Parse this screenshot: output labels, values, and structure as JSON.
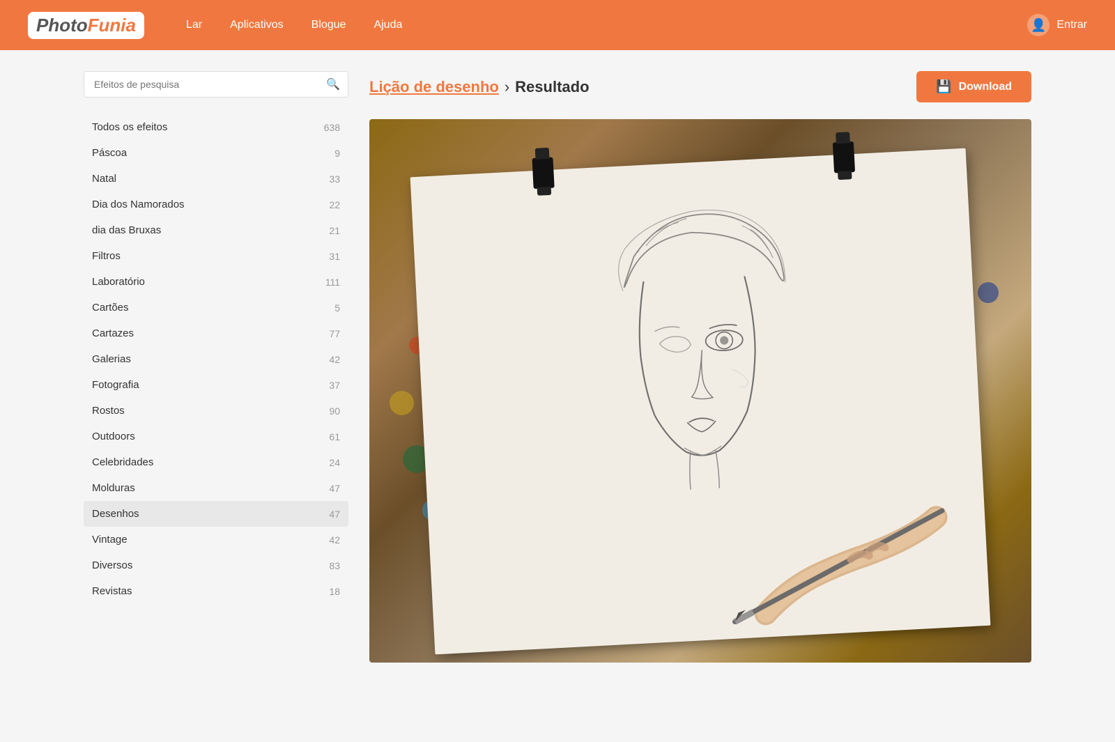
{
  "header": {
    "logo_photo": "Photo",
    "logo_funia": "Funia",
    "nav": [
      {
        "label": "Lar",
        "id": "lar"
      },
      {
        "label": "Aplicativos",
        "id": "aplicativos"
      },
      {
        "label": "Blogue",
        "id": "blogue"
      },
      {
        "label": "Ajuda",
        "id": "ajuda"
      }
    ],
    "login_label": "Entrar"
  },
  "sidebar": {
    "search_placeholder": "Efeitos de pesquisa",
    "items": [
      {
        "label": "Todos os efeitos",
        "count": "638",
        "active": false
      },
      {
        "label": "Páscoa",
        "count": "9",
        "active": false
      },
      {
        "label": "Natal",
        "count": "33",
        "active": false
      },
      {
        "label": "Dia dos Namorados",
        "count": "22",
        "active": false
      },
      {
        "label": "dia das Bruxas",
        "count": "21",
        "active": false
      },
      {
        "label": "Filtros",
        "count": "31",
        "active": false
      },
      {
        "label": "Laboratório",
        "count": "111",
        "active": false
      },
      {
        "label": "Cartões",
        "count": "5",
        "active": false
      },
      {
        "label": "Cartazes",
        "count": "77",
        "active": false
      },
      {
        "label": "Galerias",
        "count": "42",
        "active": false
      },
      {
        "label": "Fotografia",
        "count": "37",
        "active": false
      },
      {
        "label": "Rostos",
        "count": "90",
        "active": false
      },
      {
        "label": "Outdoors",
        "count": "61",
        "active": false
      },
      {
        "label": "Celebridades",
        "count": "24",
        "active": false
      },
      {
        "label": "Molduras",
        "count": "47",
        "active": false
      },
      {
        "label": "Desenhos",
        "count": "47",
        "active": true
      },
      {
        "label": "Vintage",
        "count": "42",
        "active": false
      },
      {
        "label": "Diversos",
        "count": "83",
        "active": false
      },
      {
        "label": "Revistas",
        "count": "18",
        "active": false
      }
    ]
  },
  "content": {
    "breadcrumb_link": "Lição de desenho",
    "breadcrumb_separator": "›",
    "breadcrumb_current": "Resultado",
    "download_label": "Download"
  },
  "colors": {
    "orange": "#f07840",
    "header_bg": "#f07840"
  }
}
